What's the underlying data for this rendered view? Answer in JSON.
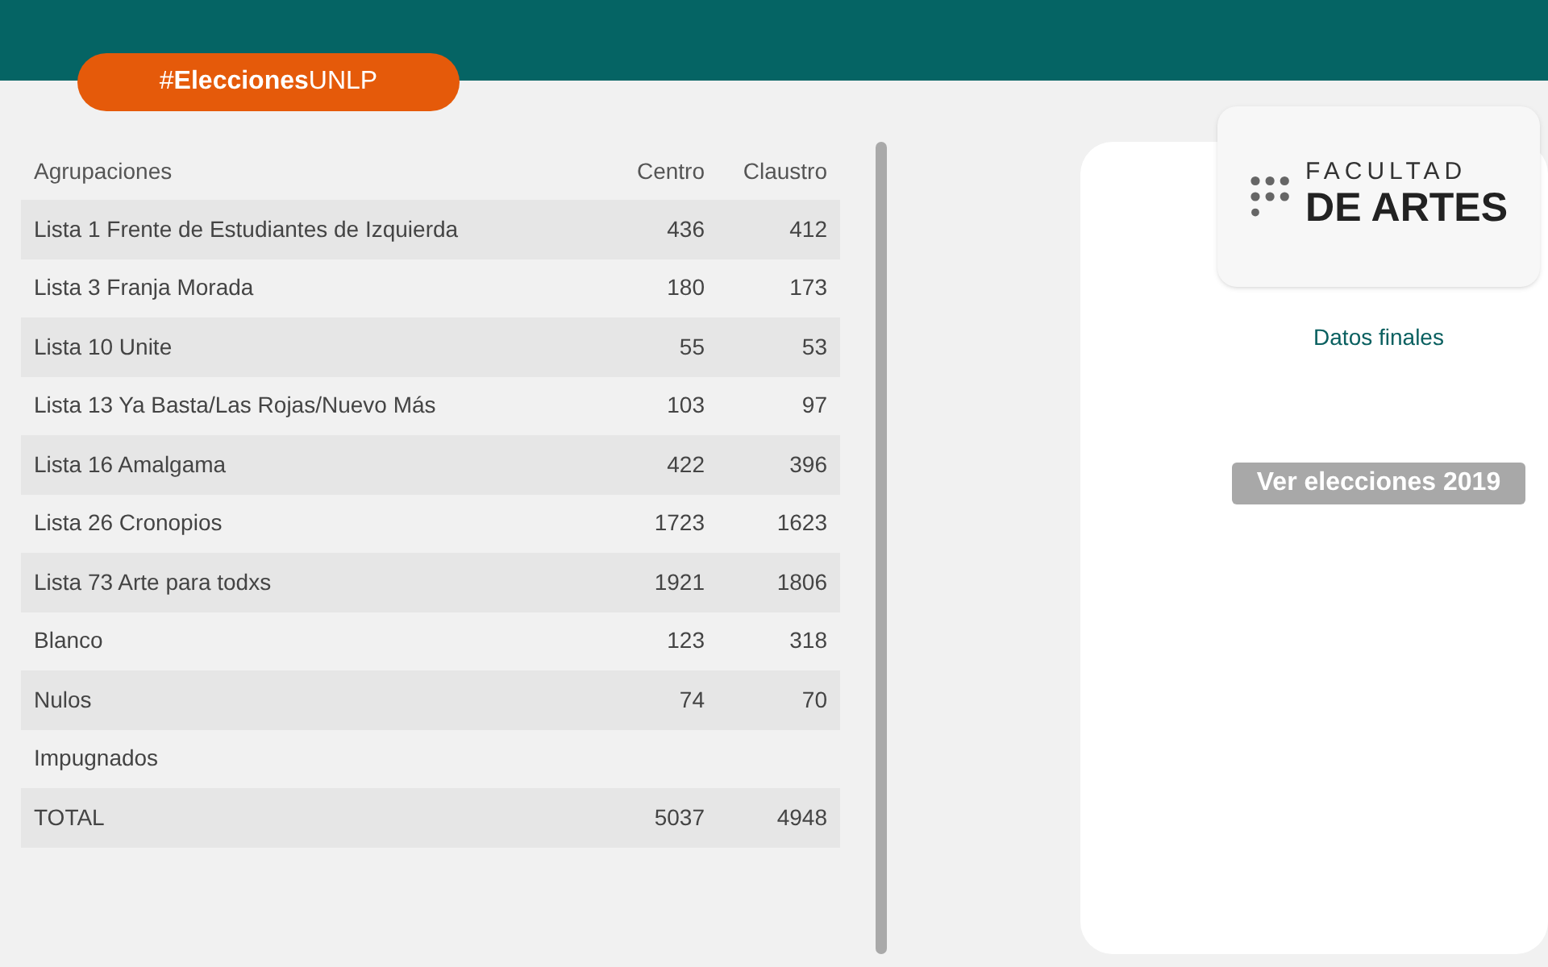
{
  "header": {
    "hashtag": "#**Elecciones**UNLP"
  },
  "table": {
    "columns": [
      "Agrupaciones",
      "Centro",
      "Claustro"
    ],
    "rows": [
      [
        "Lista 1 Frente de Estudiantes de Izquierda",
        "436",
        "412"
      ],
      [
        "Lista 3 Franja Morada",
        "180",
        "173"
      ],
      [
        "Lista 10 Unite",
        "55",
        "53"
      ],
      [
        "Lista 13 Ya Basta/Las Rojas/Nuevo Más",
        "103",
        "97"
      ],
      [
        "Lista 16 Amalgama",
        "422",
        "396"
      ],
      [
        "Lista 26 Cronopios",
        "1723",
        "1623"
      ],
      [
        "Lista 73 Arte para todxs",
        "1921",
        "1806"
      ],
      [
        "Blanco",
        "123",
        "318"
      ],
      [
        "Nulos",
        "74",
        "70"
      ],
      [
        "Impugnados"
      ],
      [
        "TOTAL",
        "5037",
        "4948"
      ]
    ]
  },
  "logo": {
    "line_1": "FACULTAD",
    "line_2": "DE ARTES"
  },
  "status": "Datos finales",
  "button": "Ver elecciones 2019"
}
